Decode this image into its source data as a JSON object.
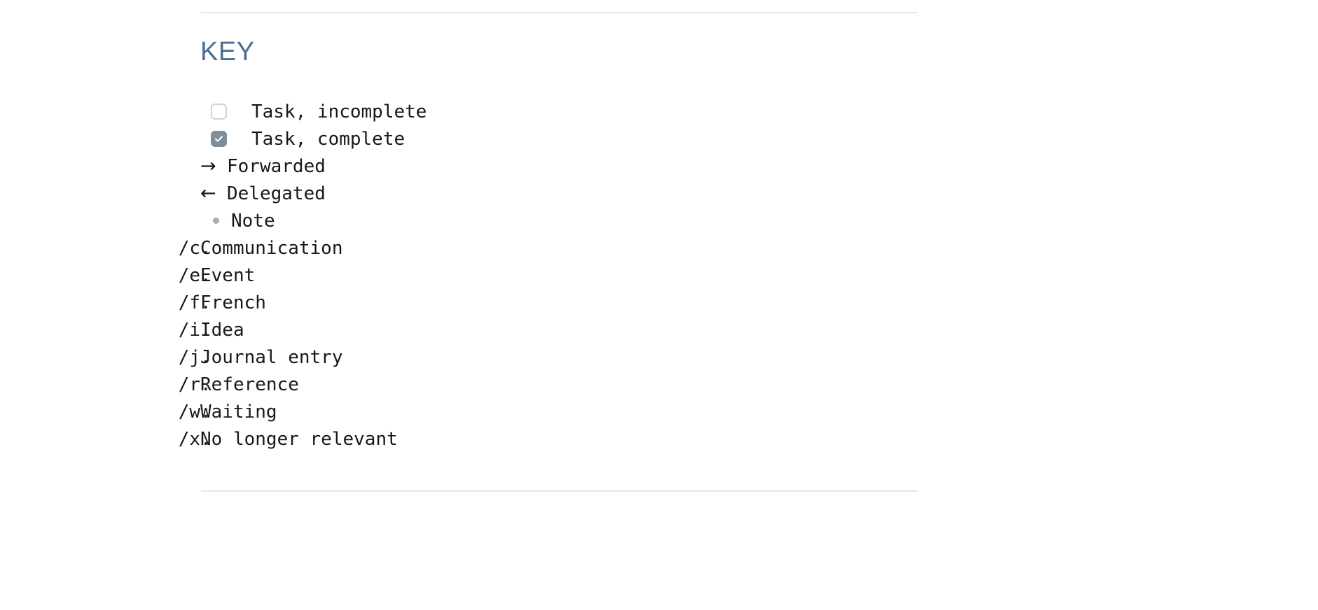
{
  "section": {
    "heading": "KEY",
    "heading_color": "#4a6f91",
    "rule_color": "#e6e6e6"
  },
  "legend": {
    "checkbox_checked_color": "#7d8f9c",
    "checkbox_unchecked_border": "#cfd3d6",
    "bullet_color": "#a9aeb2",
    "items": [
      {
        "marker_type": "checkbox-unchecked",
        "marker": "",
        "icon": "checkbox-empty-icon",
        "label": "Task, incomplete"
      },
      {
        "marker_type": "checkbox-checked",
        "marker": "",
        "icon": "checkbox-checked-icon",
        "label": "Task, complete"
      },
      {
        "marker_type": "arrow",
        "marker": "→",
        "icon": "arrow-right-icon",
        "label": "Forwarded"
      },
      {
        "marker_type": "arrow",
        "marker": "←",
        "icon": "arrow-left-icon",
        "label": "Delegated"
      },
      {
        "marker_type": "bullet",
        "marker": "",
        "icon": "bullet-dot-icon",
        "label": "Note"
      },
      {
        "marker_type": "code",
        "marker": "/c.",
        "icon": "",
        "label": "Communication"
      },
      {
        "marker_type": "code",
        "marker": "/e.",
        "icon": "",
        "label": "Event"
      },
      {
        "marker_type": "code",
        "marker": "/f.",
        "icon": "",
        "label": "French"
      },
      {
        "marker_type": "code",
        "marker": "/i.",
        "icon": "",
        "label": "Idea"
      },
      {
        "marker_type": "code",
        "marker": "/j.",
        "icon": "",
        "label": "Journal entry"
      },
      {
        "marker_type": "code",
        "marker": "/r.",
        "icon": "",
        "label": "Reference"
      },
      {
        "marker_type": "code",
        "marker": "/w.",
        "icon": "",
        "label": "Waiting"
      },
      {
        "marker_type": "code",
        "marker": "/x.",
        "icon": "",
        "label": "No longer relevant"
      }
    ]
  }
}
